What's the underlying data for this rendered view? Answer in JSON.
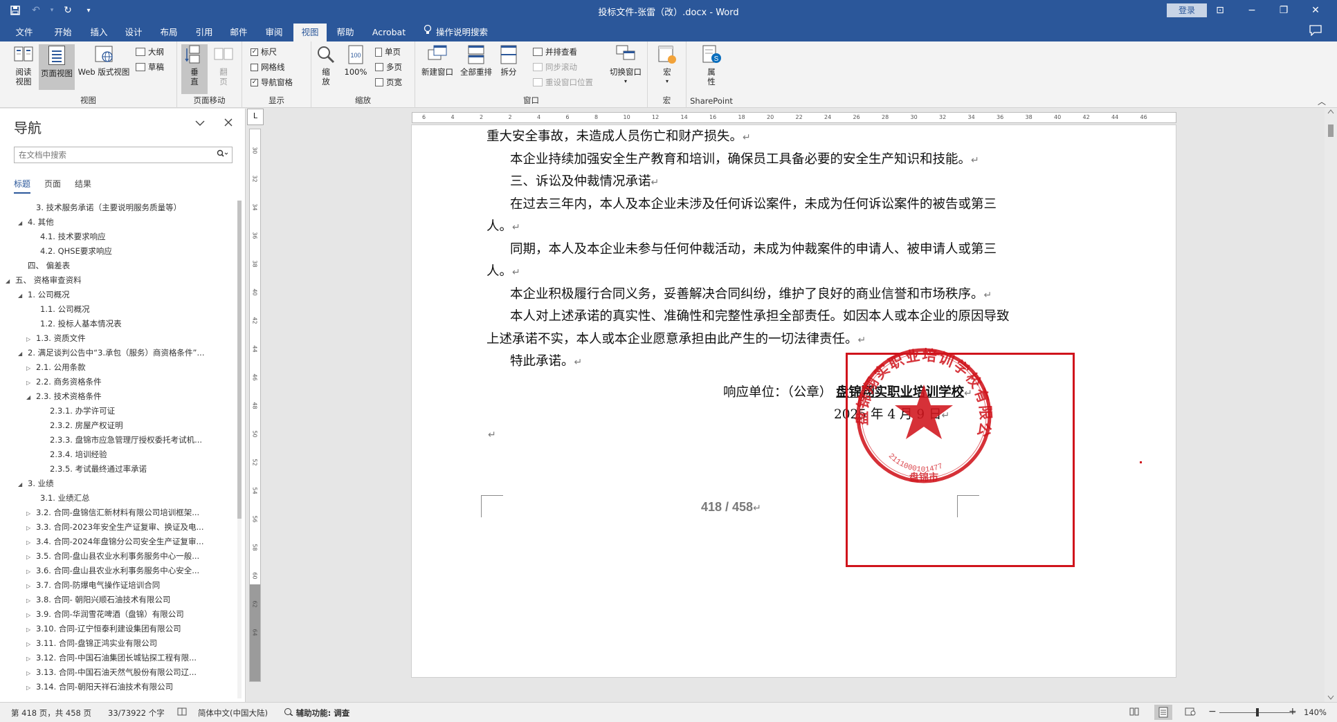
{
  "window": {
    "title": "投标文件-张雷（改）.docx - Word",
    "login_label": "登录",
    "minimize_icon": "−",
    "restore_icon": "❐",
    "close_icon": "✕",
    "ribbon_display_icon": "⊡"
  },
  "qat": {
    "save_icon": "💾",
    "undo_icon": "↶",
    "redo_icon": "↻",
    "customize_icon": "▾"
  },
  "tabs": [
    "文件",
    "开始",
    "插入",
    "设计",
    "布局",
    "引用",
    "邮件",
    "审阅",
    "视图",
    "帮助",
    "Acrobat"
  ],
  "active_tab": "视图",
  "tell_me": {
    "icon": "💡",
    "label": "操作说明搜索"
  },
  "ribbon": {
    "views": {
      "group_label": "视图",
      "read_mode": "阅读\n视图",
      "print_layout": "页面视图",
      "web_layout": "Web 版式视图",
      "outline": "大纲",
      "draft": "草稿"
    },
    "page_movement": {
      "group_label": "页面移动",
      "vertical": "垂\n直",
      "side_to_side": "翻\n页"
    },
    "show": {
      "group_label": "显示",
      "ruler": "标尺",
      "gridlines": "网格线",
      "nav_pane": "导航窗格",
      "ruler_checked": true,
      "gridlines_checked": false,
      "nav_pane_checked": true
    },
    "zoom": {
      "group_label": "缩放",
      "zoom": "缩\n放",
      "hundred": "100%",
      "one_page": "单页",
      "multiple_pages": "多页",
      "page_width": "页宽"
    },
    "window": {
      "group_label": "窗口",
      "new_window": "新建窗口",
      "arrange_all": "全部重排",
      "split": "拆分",
      "side_by_side": "并排查看",
      "sync_scroll": "同步滚动",
      "reset_position": "重设窗口位置",
      "switch_windows": "切换窗口"
    },
    "macros": {
      "group_label": "宏",
      "macros": "宏"
    },
    "sharepoint": {
      "group_label": "SharePoint",
      "properties": "属\n性"
    },
    "collapse_icon": "︿"
  },
  "nav_pane": {
    "title": "导航",
    "search_placeholder": "在文档中搜索",
    "tabs": [
      "标题",
      "页面",
      "结果"
    ],
    "active_tab": "标题",
    "items": [
      {
        "text": "3. 技术服务承诺（主要说明服务质量等）",
        "level": 2,
        "arrow": ""
      },
      {
        "text": "4. 其他",
        "level": 1,
        "arrow": "◢"
      },
      {
        "text": "4.1. 技术要求响应",
        "level": 3,
        "arrow": ""
      },
      {
        "text": "4.2. QHSE要求响应",
        "level": 3,
        "arrow": ""
      },
      {
        "text": "四、 偏差表",
        "level": 1,
        "arrow": ""
      },
      {
        "text": "五、 资格审查资料",
        "level": 0,
        "arrow": "◢"
      },
      {
        "text": "1. 公司概况",
        "level": 1,
        "arrow": "◢"
      },
      {
        "text": "1.1. 公司概况",
        "level": 3,
        "arrow": ""
      },
      {
        "text": "1.2. 投标人基本情况表",
        "level": 3,
        "arrow": ""
      },
      {
        "text": "1.3. 资质文件",
        "level": 2,
        "arrow": "▷"
      },
      {
        "text": "2. 满足谈判公告中“3.承包（服务）商资格条件”...",
        "level": 1,
        "arrow": "◢"
      },
      {
        "text": "2.1. 公用条款",
        "level": 2,
        "arrow": "▷"
      },
      {
        "text": "2.2. 商务资格条件",
        "level": 2,
        "arrow": "▷"
      },
      {
        "text": "2.3. 技术资格条件",
        "level": 2,
        "arrow": "◢"
      },
      {
        "text": "2.3.1. 办学许可证",
        "level": 4,
        "arrow": ""
      },
      {
        "text": "2.3.2. 房屋产权证明",
        "level": 4,
        "arrow": ""
      },
      {
        "text": "2.3.3. 盘锦市应急管理厅授权委托考试机...",
        "level": 4,
        "arrow": ""
      },
      {
        "text": "2.3.4. 培训经验",
        "level": 4,
        "arrow": ""
      },
      {
        "text": "2.3.5. 考试最终通过率承诺",
        "level": 4,
        "arrow": ""
      },
      {
        "text": "3. 业绩",
        "level": 1,
        "arrow": "◢"
      },
      {
        "text": "3.1. 业绩汇总",
        "level": 3,
        "arrow": ""
      },
      {
        "text": "3.2. 合同-盘锦信汇新材料有限公司培训框架...",
        "level": 2,
        "arrow": "▷"
      },
      {
        "text": "3.3. 合同-2023年安全生产证复审、换证及电...",
        "level": 2,
        "arrow": "▷"
      },
      {
        "text": "3.4. 合同-2024年盘锦分公司安全生产证复审...",
        "level": 2,
        "arrow": "▷"
      },
      {
        "text": "3.5. 合同-盘山县农业水利事务服务中心一般...",
        "level": 2,
        "arrow": "▷"
      },
      {
        "text": "3.6. 合同-盘山县农业水利事务服务中心安全...",
        "level": 2,
        "arrow": "▷"
      },
      {
        "text": "3.7. 合同-防爆电气操作证培训合同",
        "level": 2,
        "arrow": "▷"
      },
      {
        "text": "3.8. 合同- 朝阳兴顺石油技术有限公司",
        "level": 2,
        "arrow": "▷"
      },
      {
        "text": "3.9. 合同-华润雪花啤酒（盘锦）有限公司",
        "level": 2,
        "arrow": "▷"
      },
      {
        "text": "3.10. 合同-辽宁恒泰利建设集团有限公司",
        "level": 2,
        "arrow": "▷"
      },
      {
        "text": "3.11. 合同-盘锦正鸿实业有限公司",
        "level": 2,
        "arrow": "▷"
      },
      {
        "text": "3.12. 合同-中国石油集团长城钻探工程有限...",
        "level": 2,
        "arrow": "▷"
      },
      {
        "text": "3.13. 合同-中国石油天然气股份有限公司辽...",
        "level": 2,
        "arrow": "▷"
      },
      {
        "text": "3.14. 合同-朝阳天祥石油技术有限公司",
        "level": 2,
        "arrow": "▷"
      }
    ]
  },
  "ruler": {
    "h_ticks": [
      "6",
      "4",
      "2",
      "2",
      "4",
      "6",
      "8",
      "10",
      "12",
      "14",
      "16",
      "18",
      "20",
      "22",
      "24",
      "26",
      "28",
      "30",
      "32",
      "34",
      "36",
      "38",
      "40",
      "42",
      "44",
      "46"
    ],
    "v_ticks": [
      "30",
      "32",
      "34",
      "36",
      "38",
      "40",
      "42",
      "44",
      "46",
      "48",
      "50",
      "52",
      "54",
      "56",
      "58",
      "60",
      "62",
      "64"
    ],
    "corner_label": "L"
  },
  "document": {
    "lines": [
      {
        "text": "重大安全事故，未造成人员伤亡和财产损失。",
        "indent": false
      },
      {
        "text": "本企业持续加强安全生产教育和培训，确保员工具备必要的安全生产知识和技能。",
        "indent": true
      },
      {
        "text": "三、诉讼及仲裁情况承诺",
        "indent": true
      },
      {
        "text": "在过去三年内，本人及本企业未涉及任何诉讼案件，未成为任何诉讼案件的被告或第三",
        "indent": true,
        "no_mark": true
      },
      {
        "text": "人。",
        "indent": false
      },
      {
        "text": "同期，本人及本企业未参与任何仲裁活动，未成为仲裁案件的申请人、被申请人或第三",
        "indent": true,
        "no_mark": true
      },
      {
        "text": "人。",
        "indent": false
      },
      {
        "text": "本企业积极履行合同义务，妥善解决合同纠纷，维护了良好的商业信誉和市场秩序。",
        "indent": true
      },
      {
        "text": "本人对上述承诺的真实性、准确性和完整性承担全部责任。如因本人或本企业的原因导致",
        "indent": true,
        "no_mark": true
      },
      {
        "text": "上述承诺不实，本人或本企业愿意承担由此产生的一切法律责任。",
        "indent": false
      },
      {
        "text": "特此承诺。",
        "indent": true
      }
    ],
    "signature_prefix": "响应单位：（公章）",
    "signature_company": "盘锦翔实职业培训学校",
    "date_line": "2025 年 4 月 9 日",
    "paragraph_mark": "↵",
    "page_number": "418 / 458",
    "seal": {
      "outer_text": "盘锦翔实职业培训学校有限公司",
      "code": "2111000101477",
      "bottom_text": "盘锦市",
      "color": "#d0141c"
    }
  },
  "status_bar": {
    "page": "第 418 页，共 458 页",
    "words": "33/73922 个字",
    "proofing_icon": "📖",
    "language": "简体中文(中国大陆)",
    "accessibility": "辅助功能: 调查",
    "zoom_out": "−",
    "zoom_in": "+",
    "zoom_level": "140%",
    "zoom_fraction": 0.5
  },
  "colors": {
    "accent": "#2b579a",
    "seal_red": "#d0141c"
  }
}
